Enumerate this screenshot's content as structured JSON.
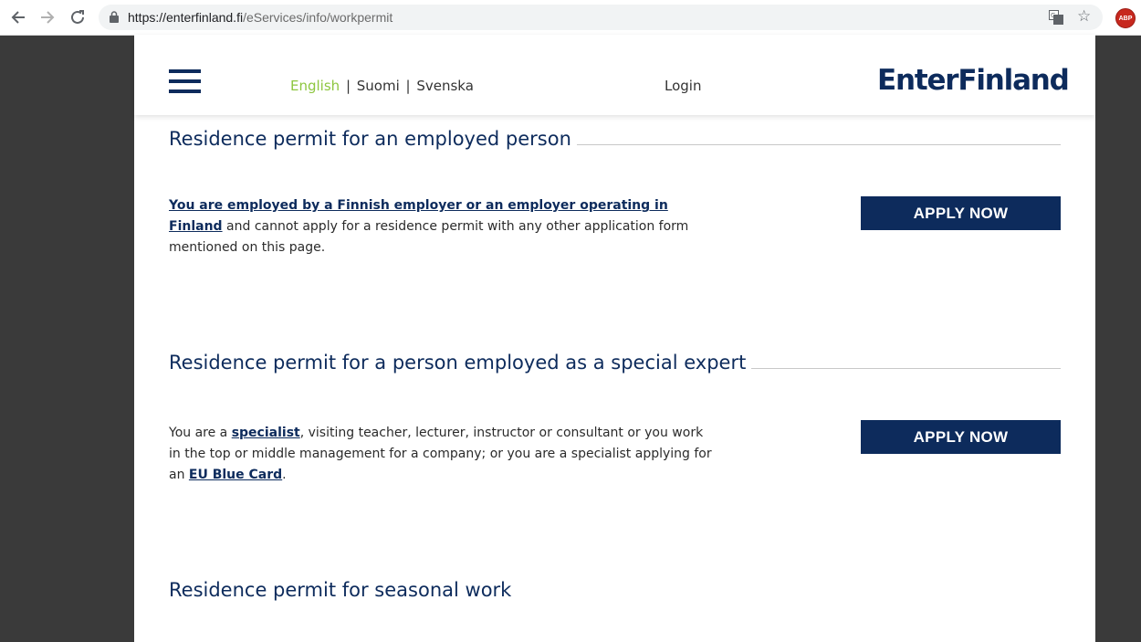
{
  "browser": {
    "url_domain": "https://enterfinland.fi",
    "url_path": "/eServices/info/workpermit",
    "extension_badge": "ABP"
  },
  "header": {
    "languages": [
      "English",
      "Suomi",
      "Svenska"
    ],
    "login_label": "Login",
    "logo_text": "EnterFinland"
  },
  "sections": [
    {
      "title": "Residence permit for an employed person",
      "desc_link": "You are employed by a Finnish employer or an employer operating in Finland",
      "desc_rest": " and cannot apply for a residence permit with any other application form mentioned on this page.",
      "button": "APPLY NOW"
    },
    {
      "title": "Residence permit for a person employed as a special expert",
      "desc_pre": "You are a ",
      "desc_link1": "specialist",
      "desc_mid": ", visiting teacher, lecturer, instructor or consultant or you work in the top or middle management for a company; or you are a specialist applying for an ",
      "desc_link2": "EU Blue Card",
      "desc_end": ".",
      "button": "APPLY NOW"
    },
    {
      "title": "Residence permit for seasonal work"
    }
  ],
  "colors": {
    "brand_navy": "#0d2b5c",
    "active_language": "#8dc63f"
  }
}
